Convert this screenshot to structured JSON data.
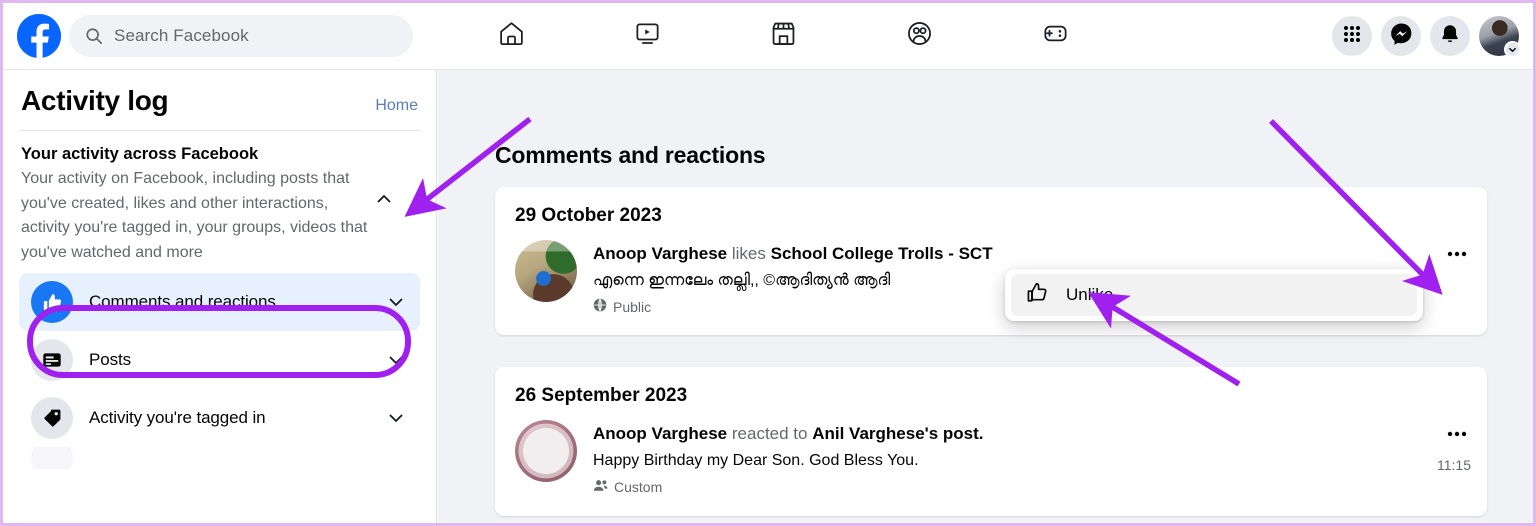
{
  "topbar": {
    "logo_icon": "facebook-logo-icon",
    "search": {
      "placeholder": "Search Facebook",
      "value": "",
      "icon": "search-icon"
    },
    "nav": [
      {
        "name": "home",
        "icon": "home-icon"
      },
      {
        "name": "video",
        "icon": "video-icon"
      },
      {
        "name": "marketplace",
        "icon": "marketplace-icon"
      },
      {
        "name": "groups",
        "icon": "groups-icon"
      },
      {
        "name": "gaming",
        "icon": "gaming-icon"
      }
    ],
    "actions": [
      {
        "name": "menu",
        "icon": "grid-menu-icon"
      },
      {
        "name": "messenger",
        "icon": "messenger-icon"
      },
      {
        "name": "notifications",
        "icon": "bell-icon"
      }
    ],
    "account": {
      "icon": "avatar",
      "chevron": "chevron-down-icon"
    }
  },
  "sidebar": {
    "title": "Activity log",
    "home_link": "Home",
    "section": {
      "heading": "Your activity across Facebook",
      "description": "Your activity on Facebook, including posts that you've created, likes and other interactions, activity you're tagged in, your groups, videos that you've watched and more",
      "collapse_icon": "chevron-up-icon"
    },
    "items": [
      {
        "label": "Comments and reactions",
        "icon": "thumbs-up-icon",
        "selected": true,
        "chevron": "chevron-down-icon"
      },
      {
        "label": "Posts",
        "icon": "posts-icon",
        "selected": false,
        "chevron": "chevron-down-icon"
      },
      {
        "label": "Activity you're tagged in",
        "icon": "tag-icon",
        "selected": false,
        "chevron": "chevron-down-icon"
      }
    ]
  },
  "main": {
    "title": "Comments and reactions",
    "cards": [
      {
        "date": "29 October 2023",
        "avatar": "school-photo",
        "actor": "Anoop Varghese",
        "verb": "likes",
        "target": "School College Trolls - SCT",
        "body": "എന്നെ ഇന്നലേം തല്ലി,, ©ആദിത്യൻ ആദി",
        "privacy": "Public",
        "privacy_icon": "globe-icon",
        "time": "",
        "options_icon": "ellipsis-icon"
      },
      {
        "date": "26 September 2023",
        "avatar": "cake-photo",
        "actor": "Anoop Varghese",
        "verb": "reacted to",
        "target": "Anil Varghese",
        "target_suffix": "'s post.",
        "body": "Happy Birthday my Dear Son. God Bless You.",
        "privacy": "Custom",
        "privacy_icon": "people-icon",
        "time": "11:15",
        "options_icon": "ellipsis-icon"
      }
    ]
  },
  "popup": {
    "items": [
      {
        "label": "Unlike",
        "icon": "thumbs-up-outline-icon"
      }
    ]
  },
  "colors": {
    "brand_blue": "#0866ff",
    "selected_blue": "#e7f0fd",
    "annotation_purple": "#a020f0",
    "page_bg": "#f0f2f5",
    "card_bg": "#ffffff",
    "text_primary": "#050505",
    "text_secondary": "#65676b",
    "link_blue": "#5a7dbd"
  },
  "annotations": {
    "arrows": 3,
    "highlight_box": "comments-and-reactions"
  }
}
